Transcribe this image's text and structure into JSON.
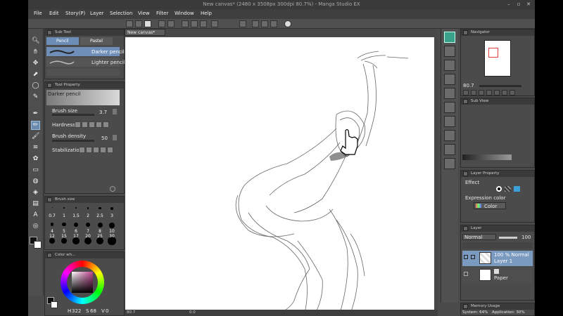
{
  "window": {
    "title": "New canvas* (2480 x 3508px 300dpi 80.7%) - Manga Studio EX"
  },
  "menu": [
    "File",
    "Edit",
    "Story(P)",
    "Layer",
    "Selection",
    "View",
    "Filter",
    "Window",
    "Help"
  ],
  "sub_tool": {
    "header": "Sub Tool",
    "tabs": [
      "Pencil",
      "Pastel"
    ],
    "brushes": [
      "Darker pencil",
      "Lighter pencil"
    ]
  },
  "tool_property": {
    "header": "Tool Property",
    "preset": "Darker pencil",
    "brush_size_label": "Brush size",
    "brush_size_value": "3.7",
    "hardness_label": "Hardness",
    "brush_density_label": "Brush density",
    "brush_density_value": "50",
    "stabilization_label": "Stabilization"
  },
  "brush_size": {
    "header": "Brush size",
    "sizes": [
      "0.7",
      "1",
      "1.5",
      "2",
      "2.5",
      "3",
      "4",
      "5",
      "6",
      "7",
      "8",
      "10",
      "12",
      "15",
      "17",
      "20",
      "25",
      "30"
    ]
  },
  "color_wheel": {
    "header": "Color wh...",
    "h_value": "322",
    "s_value": "68",
    "v_value": "0"
  },
  "canvas": {
    "tab": "New canvas*",
    "zoom": "80.7",
    "rotation": "0.0"
  },
  "navigator": {
    "header": "Navigator",
    "zoom": "80.7"
  },
  "sub_view": {
    "header": "Sub View"
  },
  "layer_property": {
    "header": "Layer Property",
    "effect_label": "Effect",
    "expression_label": "Expression color",
    "expression_value": "Color"
  },
  "layer_panel": {
    "header": "Layer",
    "blend_mode": "Normal",
    "opacity": "100",
    "layers": [
      {
        "opacity_mode": "100 %  Normal",
        "name": "Layer 1"
      },
      {
        "opacity_mode": "",
        "name": "Paper"
      }
    ]
  },
  "memory": {
    "header": "Memory Usage",
    "system": "System: 64%",
    "application": "Application: 30%"
  }
}
